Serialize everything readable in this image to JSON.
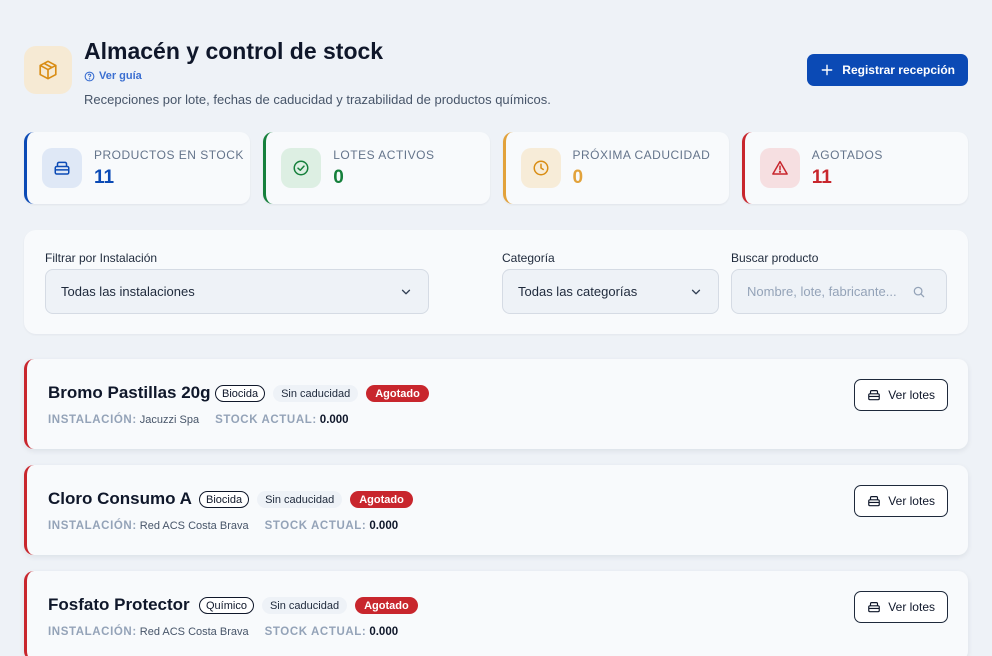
{
  "header": {
    "title": "Almacén y control de stock",
    "guide_link": "Ver guía",
    "subtitle": "Recepciones por lote, fechas de caducidad y trazabilidad de productos químicos.",
    "primary_action": "Registrar recepción",
    "icon": "box-icon"
  },
  "stats": [
    {
      "label": "PRODUCTOS EN STOCK",
      "value": "11",
      "color": "#0b4ab5",
      "icon": "stack-icon"
    },
    {
      "label": "LOTES ACTIVOS",
      "value": "0",
      "color": "#16803c",
      "icon": "check-circle-icon"
    },
    {
      "label": "PRÓXIMA CADUCIDAD",
      "value": "0",
      "color": "#e2a23b",
      "icon": "clock-icon"
    },
    {
      "label": "AGOTADOS",
      "value": "11",
      "color": "#c8262d",
      "icon": "warning-icon"
    }
  ],
  "filters": {
    "facility_label": "Filtrar por Instalación",
    "facility_value": "Todas las instalaciones",
    "category_label": "Categoría",
    "category_value": "Todas las categorías",
    "search_label": "Buscar producto",
    "search_placeholder": "Nombre, lote, fabricante..."
  },
  "products": [
    {
      "name": "Bromo Pastillas 20g",
      "type": "Biocida",
      "expiry": "Sin caducidad",
      "status": "Agotado",
      "facility_key": "INSTALACIÓN:",
      "facility": "Jacuzzi Spa",
      "stock_key": "STOCK ACTUAL:",
      "stock": "0.000",
      "action": "Ver lotes"
    },
    {
      "name": "Cloro Consumo A",
      "type": "Biocida",
      "expiry": "Sin caducidad",
      "status": "Agotado",
      "facility_key": "INSTALACIÓN:",
      "facility": "Red ACS Costa Brava",
      "stock_key": "STOCK ACTUAL:",
      "stock": "0.000",
      "action": "Ver lotes"
    },
    {
      "name": "Fosfato Protector",
      "type": "Químico",
      "expiry": "Sin caducidad",
      "status": "Agotado",
      "facility_key": "INSTALACIÓN:",
      "facility": "Red ACS Costa Brava",
      "stock_key": "STOCK ACTUAL:",
      "stock": "0.000",
      "action": "Ver lotes"
    }
  ]
}
